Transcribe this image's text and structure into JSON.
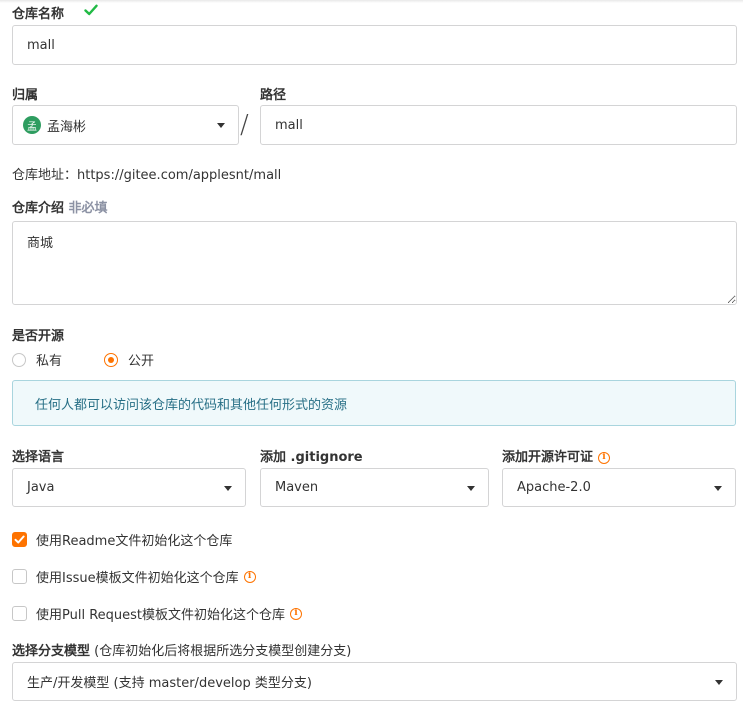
{
  "repo_name": {
    "label": "仓库名称",
    "value": "mall"
  },
  "owner": {
    "label": "归属",
    "avatar_char": "孟",
    "value": "孟海彬"
  },
  "path": {
    "label": "路径",
    "separator": "/",
    "value": "mall"
  },
  "repo_url": {
    "text": "仓库地址：https://gitee.com/applesnt/mall"
  },
  "description": {
    "label": "仓库介绍",
    "optional": "非必填",
    "value": "商城"
  },
  "visibility": {
    "label": "是否开源",
    "options": [
      "私有",
      "公开"
    ],
    "selected": "公开",
    "notice": "任何人都可以访问该仓库的代码和其他任何形式的资源"
  },
  "language": {
    "label": "选择语言",
    "value": "Java"
  },
  "gitignore": {
    "label": "添加 .gitignore",
    "value": "Maven"
  },
  "license": {
    "label": "添加开源许可证",
    "value": "Apache-2.0"
  },
  "init_options": [
    {
      "label": "使用Readme文件初始化这个仓库",
      "checked": true,
      "info": false
    },
    {
      "label": "使用Issue模板文件初始化这个仓库",
      "checked": false,
      "info": true
    },
    {
      "label": "使用Pull Request模板文件初始化这个仓库",
      "checked": false,
      "info": true
    }
  ],
  "branch_model": {
    "label": "选择分支模型",
    "hint": " (仓库初始化后将根据所选分支模型创建分支)",
    "value": "生产/开发模型 (支持 master/develop 类型分支)"
  },
  "colors": {
    "accent": "#fe7300",
    "success": "#21ba45",
    "info_text": "#276f86",
    "info_bg": "#f0f9fb"
  }
}
